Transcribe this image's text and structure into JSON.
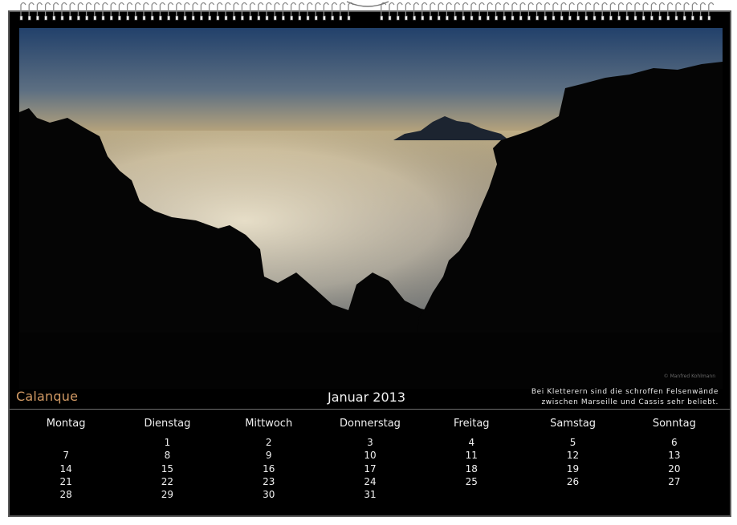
{
  "calendar": {
    "photo_title": "Calanque",
    "month_label": "Januar 2013",
    "photo_credit": "© Manfred Kohlmann",
    "caption_lines": [
      "Bei Kletterern  sind die schroffen Felsenwände",
      "zwischen Marseille und Cassis sehr beliebt."
    ],
    "weekdays": [
      "Montag",
      "Dienstag",
      "Mittwoch",
      "Donnerstag",
      "Freitag",
      "Samstag",
      "Sonntag"
    ],
    "weeks": [
      [
        "",
        "1",
        "2",
        "3",
        "4",
        "5",
        "6"
      ],
      [
        "7",
        "8",
        "9",
        "10",
        "11",
        "12",
        "13"
      ],
      [
        "14",
        "15",
        "16",
        "17",
        "18",
        "19",
        "20"
      ],
      [
        "21",
        "22",
        "23",
        "24",
        "25",
        "26",
        "27"
      ],
      [
        "28",
        "29",
        "30",
        "31",
        "",
        "",
        ""
      ]
    ]
  },
  "colors": {
    "background": "#000000",
    "title_accent": "#d29a64",
    "text": "#f0f0f0",
    "divider": "#6e6e6e"
  },
  "icons": {
    "binding": "spiral-binding-icon",
    "hanger": "hanger-icon"
  }
}
